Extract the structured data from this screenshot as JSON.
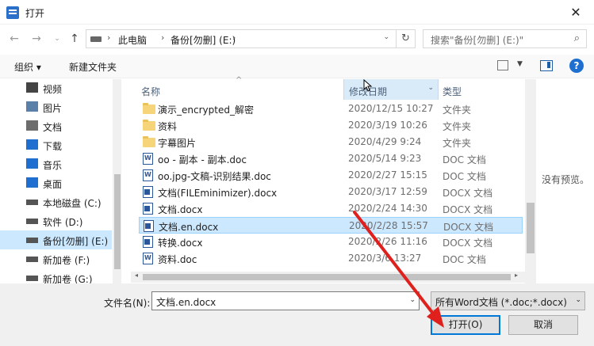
{
  "window": {
    "title": "打开",
    "close_glyph": "✕"
  },
  "nav": {
    "back_glyph": "←",
    "forward_glyph": "→",
    "recent_glyph": "⌄",
    "up_glyph": "↑",
    "breadcrumbs": [
      "此电脑",
      "备份[勿删] (E:)"
    ],
    "refresh_glyph": "↻",
    "search_placeholder": "搜索\"备份[勿删] (E:)\"",
    "search_glyph": "⌕"
  },
  "toolbar": {
    "organize": "组织 ▾",
    "new_folder": "新建文件夹",
    "view_drop": "▼",
    "help_glyph": "?"
  },
  "sidebar": {
    "items": [
      {
        "label": "视频",
        "icon": "video-icon",
        "color": "#444444"
      },
      {
        "label": "图片",
        "icon": "picture-icon",
        "color": "#5a7fa8"
      },
      {
        "label": "文档",
        "icon": "document-icon",
        "color": "#6d6d6d"
      },
      {
        "label": "下载",
        "icon": "download-icon",
        "color": "#1f6fd0"
      },
      {
        "label": "音乐",
        "icon": "music-icon",
        "color": "#1f6fd0"
      },
      {
        "label": "桌面",
        "icon": "desktop-icon",
        "color": "#1f6fd0"
      },
      {
        "label": "本地磁盘 (C:)",
        "icon": "drive-icon",
        "color": "#555555"
      },
      {
        "label": "软件 (D:)",
        "icon": "drive-icon",
        "color": "#555555"
      },
      {
        "label": "备份[勿删] (E:)",
        "icon": "drive-icon",
        "color": "#555555"
      },
      {
        "label": "新加卷 (F:)",
        "icon": "drive-icon",
        "color": "#555555"
      },
      {
        "label": "新加卷 (G:)",
        "icon": "drive-icon",
        "color": "#555555"
      }
    ],
    "selected_index": 8
  },
  "columns": {
    "name": "名称",
    "date": "修改日期",
    "type": "类型",
    "sort_glyph": "^",
    "date_caret": "⌄"
  },
  "files": [
    {
      "name": "演示_encrypted_解密",
      "date": "2020/12/15 10:27",
      "type": "文件夹",
      "kind": "folder"
    },
    {
      "name": "资料",
      "date": "2020/3/19 10:26",
      "type": "文件夹",
      "kind": "folder"
    },
    {
      "name": "字幕图片",
      "date": "2020/4/29 9:24",
      "type": "文件夹",
      "kind": "folder"
    },
    {
      "name": "oo - 副本 - 副本.doc",
      "date": "2020/5/14 9:23",
      "type": "DOC 文档",
      "kind": "doc"
    },
    {
      "name": "oo.jpg-文稿-识别结果.doc",
      "date": "2020/2/27 15:15",
      "type": "DOC 文档",
      "kind": "doc"
    },
    {
      "name": "文档(FILEminimizer).docx",
      "date": "2020/3/17 12:59",
      "type": "DOCX 文档",
      "kind": "docx"
    },
    {
      "name": "文档.docx",
      "date": "2020/2/24 14:30",
      "type": "DOCX 文档",
      "kind": "docx"
    },
    {
      "name": "文档.en.docx",
      "date": "2020/2/28 15:57",
      "type": "DOCX 文档",
      "kind": "docx"
    },
    {
      "name": "转换.docx",
      "date": "2020/2/26 11:16",
      "type": "DOCX 文档",
      "kind": "docx"
    },
    {
      "name": "资料.doc",
      "date": "2020/3/6 13:27",
      "type": "DOC 文档",
      "kind": "doc"
    }
  ],
  "selected_file_index": 7,
  "preview": {
    "text": "没有预览。"
  },
  "bottom": {
    "filename_label": "文件名(N):",
    "filename_value": "文档.en.docx",
    "filter_value": "所有Word文档 (*.doc;*.docx)",
    "caret": "⌄",
    "open_label": "打开(O)",
    "cancel_label": "取消"
  },
  "scroll": {
    "left_glyph": "◂",
    "right_glyph": "▸"
  },
  "colors": {
    "accent": "#0078d7",
    "selection": "#cce8ff",
    "arrow": "#e0201c"
  }
}
